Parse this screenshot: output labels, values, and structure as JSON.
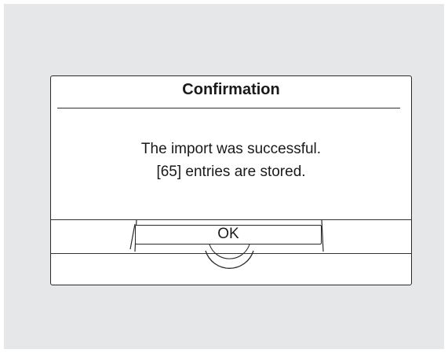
{
  "dialog": {
    "title": "Confirmation",
    "message_lines": [
      "The import was successful.",
      "[65] entries are stored."
    ],
    "ok_label": "OK"
  },
  "colors": {
    "screen_background": "#e6e7e8",
    "dialog_background": "#ffffff",
    "stroke": "#2a2a2a"
  }
}
